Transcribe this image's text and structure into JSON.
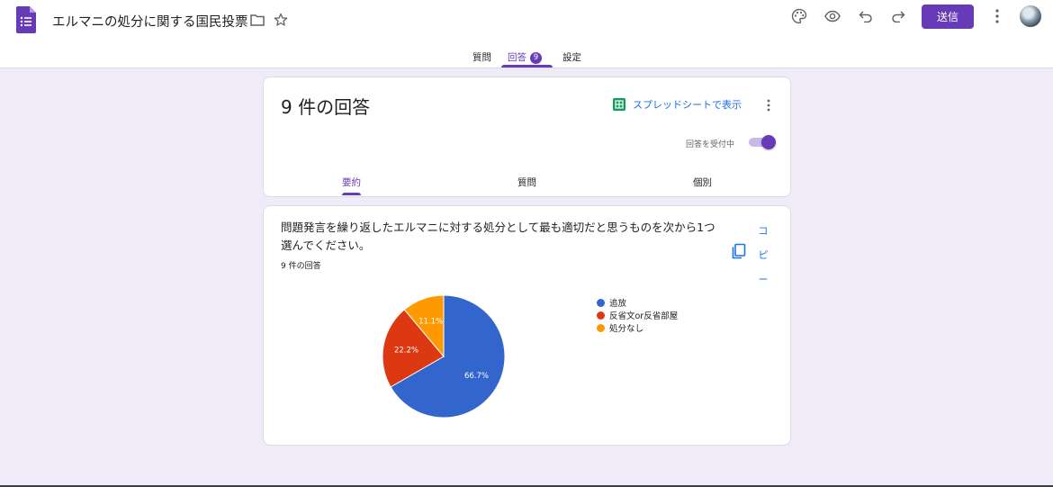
{
  "header": {
    "title": "エルマニの処分に関する国民投票",
    "send_label": "送信"
  },
  "nav": {
    "tabs": [
      {
        "label": "質問"
      },
      {
        "label": "回答",
        "badge": "9"
      },
      {
        "label": "設定"
      }
    ],
    "active": "回答"
  },
  "summary_card": {
    "response_count": "9 件の回答",
    "sheet_link": "スプレッドシートで表示",
    "accepting_label": "回答を受付中",
    "accepting": true,
    "tabs": [
      "要約",
      "質問",
      "個別"
    ],
    "active_tab": "要約"
  },
  "question_card": {
    "question": "問題発言を繰り返したエルマニに対する処分として最も適切だと思うものを次から1つ選んでください。",
    "response_count": "9 件の回答",
    "copy_label": "コピー"
  },
  "chart_data": {
    "type": "pie",
    "categories": [
      "追放",
      "反省文or反省部屋",
      "処分なし"
    ],
    "values": [
      66.7,
      22.2,
      11.1
    ],
    "labels": [
      "66.7%",
      "22.2%",
      "11.1%"
    ],
    "colors": [
      "#3366cc",
      "#dc3912",
      "#ff9900"
    ],
    "legend": "right"
  },
  "icons": {
    "app": "forms-icon",
    "folder": "folder-icon",
    "star": "star-icon",
    "palette": "palette-icon",
    "preview": "eye-icon",
    "undo": "undo-icon",
    "redo": "redo-icon",
    "more": "more-vert-icon",
    "sheets": "sheets-icon",
    "copy": "copy-icon"
  },
  "colors": {
    "accent": "#673ab7",
    "background": "#f0ebf8",
    "link": "#1a73e8"
  }
}
